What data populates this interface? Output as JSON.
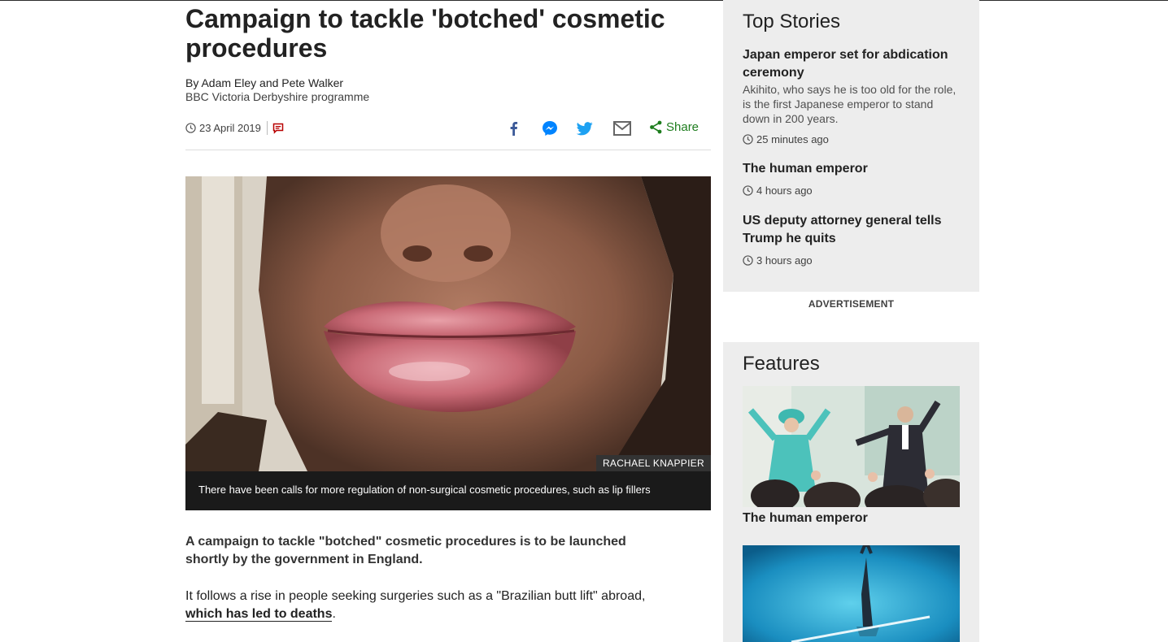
{
  "article": {
    "headline": "Campaign to tackle 'botched' cosmetic procedures",
    "authors": "By Adam Eley and Pete Walker",
    "programme": "BBC Victoria Derbyshire programme",
    "date": "23 April 2019",
    "share_label": "Share",
    "image_credit": "RACHAEL KNAPPIER",
    "image_caption": "There have been calls for more regulation of non-surgical cosmetic procedures, such as lip fillers",
    "lead": "A campaign to tackle \"botched\" cosmetic procedures is to be launched shortly by the government in England.",
    "para2_text": "It follows a rise in people seeking surgeries such as a \"Brazilian butt lift\" abroad,",
    "para2_link": "which has led to deaths",
    "para2_end": "."
  },
  "share_icons": [
    "facebook-icon",
    "messenger-icon",
    "twitter-icon",
    "email-icon",
    "share-icon"
  ],
  "top_stories": {
    "title": "Top Stories",
    "items": [
      {
        "title": "Japan emperor set for abdication ceremony",
        "summary": "Akihito, who says he is too old for the role, is the first Japanese emperor to stand down in 200 years.",
        "time": "25 minutes ago"
      },
      {
        "title": "The human emperor",
        "time": "4 hours ago"
      },
      {
        "title": "US deputy attorney general tells Trump he quits",
        "time": "3 hours ago"
      }
    ]
  },
  "advertisement_label": "ADVERTISEMENT",
  "features": {
    "title": "Features",
    "items": [
      {
        "title": "The human emperor"
      }
    ]
  },
  "colors": {
    "share_green": "#1e7d1e",
    "facebook": "#3b5998",
    "messenger": "#0084ff",
    "twitter": "#1da1f2",
    "comment_red": "#b80000",
    "sidebar_bg": "#ededed"
  }
}
